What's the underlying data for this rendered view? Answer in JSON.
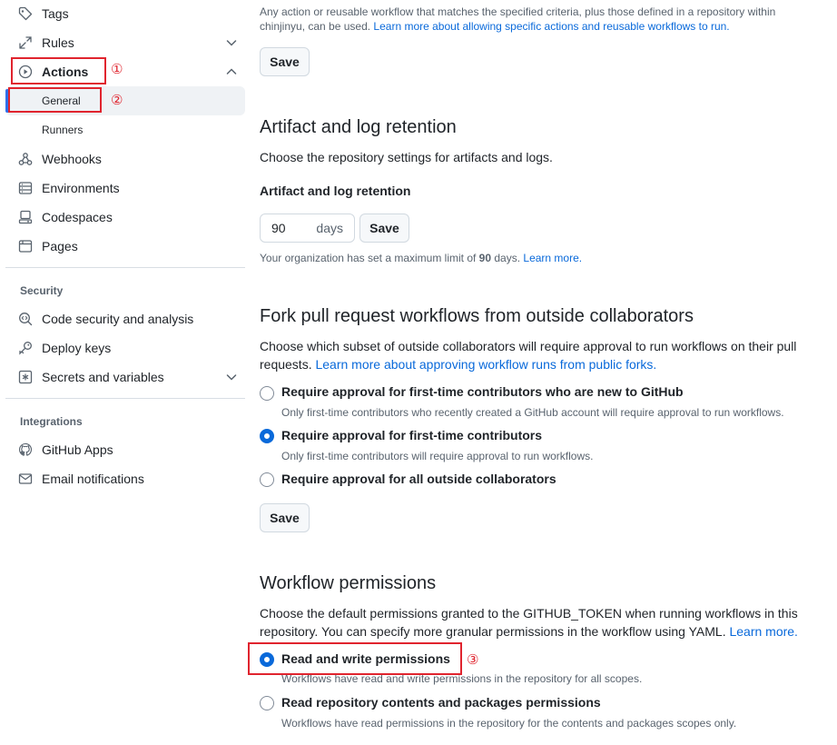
{
  "sidebar": {
    "items": [
      {
        "label": "Tags",
        "icon": "tag-icon"
      },
      {
        "label": "Rules",
        "icon": "rules-icon"
      },
      {
        "label": "Actions",
        "icon": "play-icon"
      },
      {
        "label": "General"
      },
      {
        "label": "Runners"
      },
      {
        "label": "Webhooks",
        "icon": "webhook-icon"
      },
      {
        "label": "Environments",
        "icon": "server-icon"
      },
      {
        "label": "Codespaces",
        "icon": "codespaces-icon"
      },
      {
        "label": "Pages",
        "icon": "browser-icon"
      }
    ],
    "security_title": "Security",
    "security_items": [
      {
        "label": "Code security and analysis",
        "icon": "codescan-icon"
      },
      {
        "label": "Deploy keys",
        "icon": "key-icon"
      },
      {
        "label": "Secrets and variables",
        "icon": "asterisk-icon"
      }
    ],
    "integrations_title": "Integrations",
    "integrations_items": [
      {
        "label": "GitHub Apps",
        "icon": "apps-icon"
      },
      {
        "label": "Email notifications",
        "icon": "mail-icon"
      }
    ]
  },
  "annotations": [
    "①",
    "②",
    "③"
  ],
  "colors": {
    "accent": "#0969da",
    "annotation": "#e0242e",
    "active_bar": "#2f6feb"
  },
  "allowed_actions": {
    "help_line1": "Any action or reusable workflow that matches the specified criteria, plus those defined in a repository within",
    "help_line2_prefix": "chinjinyu, can be used. ",
    "help_link": "Learn more about allowing specific actions and reusable workflows to run.",
    "save_label": "Save"
  },
  "retention": {
    "title": "Artifact and log retention",
    "description": "Choose the repository settings for artifacts and logs.",
    "field_label": "Artifact and log retention",
    "value": "90",
    "unit": "days",
    "save_label": "Save",
    "note_prefix": "Your organization has set a maximum limit of ",
    "note_bold": "90",
    "note_suffix": " days. ",
    "note_link": "Learn more."
  },
  "fork": {
    "title": "Fork pull request workflows from outside collaborators",
    "desc_line1": "Choose which subset of outside collaborators will require approval to run workflows on their pull",
    "desc_line2_prefix": "requests. ",
    "desc_link": "Learn more about approving workflow runs from public forks.",
    "options": [
      {
        "label": "Require approval for first-time contributors who are new to GitHub",
        "help": "Only first-time contributors who recently created a GitHub account will require approval to run workflows.",
        "checked": false
      },
      {
        "label": "Require approval for first-time contributors",
        "help": "Only first-time contributors will require approval to run workflows.",
        "checked": true
      },
      {
        "label": "Require approval for all outside collaborators",
        "help": "",
        "checked": false
      }
    ],
    "save_label": "Save"
  },
  "permissions": {
    "title": "Workflow permissions",
    "desc_line1": "Choose the default permissions granted to the GITHUB_TOKEN when running workflows in this",
    "desc_line2_prefix": "repository. You can specify more granular permissions in the workflow using YAML. ",
    "desc_link": "Learn more.",
    "options": [
      {
        "label": "Read and write permissions",
        "help": "Workflows have read and write permissions in the repository for all scopes.",
        "checked": true
      },
      {
        "label": "Read repository contents and packages permissions",
        "help": "Workflows have read permissions in the repository for the contents and packages scopes only.",
        "checked": false
      }
    ]
  }
}
